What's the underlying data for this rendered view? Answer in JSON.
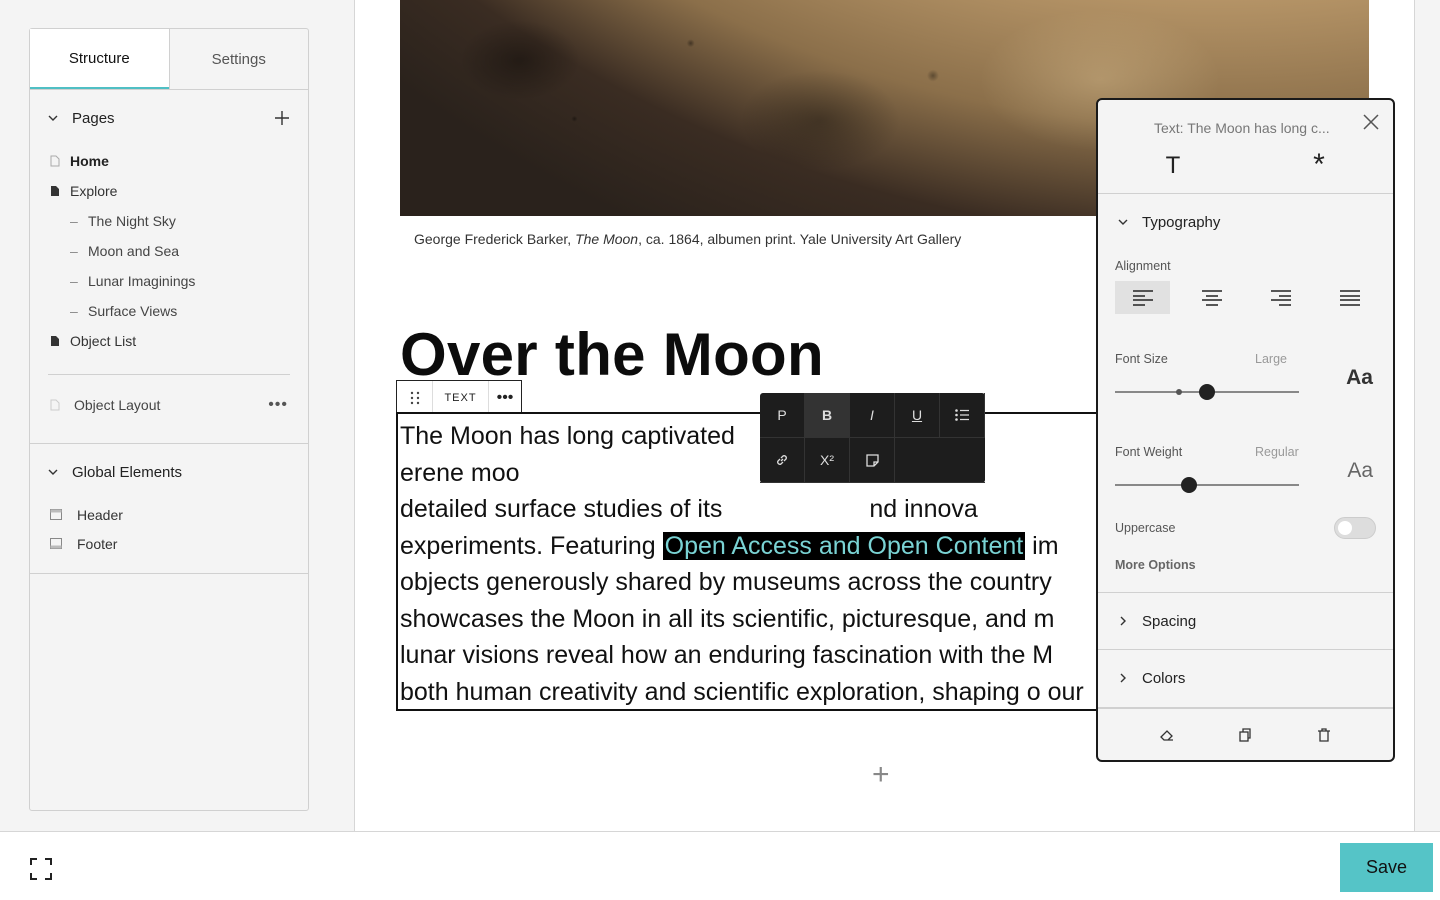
{
  "sidebar": {
    "tabs": [
      "Structure",
      "Settings"
    ],
    "pages_title": "Pages",
    "pages": [
      {
        "label": "Home"
      },
      {
        "label": "Explore"
      },
      {
        "label": "The Night Sky"
      },
      {
        "label": "Moon and Sea"
      },
      {
        "label": "Lunar Imaginings"
      },
      {
        "label": "Surface Views"
      },
      {
        "label": "Object List"
      }
    ],
    "object_layout": "Object Layout",
    "global_title": "Global Elements",
    "global_items": [
      "Header",
      "Footer"
    ]
  },
  "canvas": {
    "caption_pre": "George Frederick Barker, ",
    "caption_italic": "The Moon",
    "caption_post": ", ca. 1864, albumen print. Yale University Art Gallery",
    "heading": "Over the Moon",
    "block_label": "TEXT",
    "body_before": "The Moon has long captivated",
    "body_hidden1": " erene moo",
    "body_line2_a": "detailed surface studies of its ",
    "body_line2_b": "nd innova",
    "body_line3_a": "experiments. Featuring ",
    "body_highlight": "Open Access and Open Content",
    "body_line3_b": " im",
    "body_rest": "objects generously shared by museums across the country showcases the Moon in all its scientific, picturesque, and m lunar visions reveal how an enduring fascination with the M both human creativity and scientific exploration, shaping o our closest celestial neighbor."
  },
  "format_toolbar": {
    "row1": [
      "P",
      "B",
      "I",
      "U"
    ],
    "superscript": "X²"
  },
  "panel": {
    "title": "Text: The Moon has long c...",
    "tab_text": "T",
    "tab_style": "*",
    "typography": "Typography",
    "alignment": "Alignment",
    "font_size_label": "Font Size",
    "font_size_value": "Large",
    "font_size_level": 0.5,
    "font_weight_label": "Font Weight",
    "font_weight_value": "Regular",
    "font_weight_level": 0.4,
    "sample": "Aa",
    "uppercase": "Uppercase",
    "uppercase_on": false,
    "more_options": "More Options",
    "spacing": "Spacing",
    "colors": "Colors"
  },
  "bottom": {
    "save": "Save"
  },
  "colors": {
    "accent": "#55c4c7",
    "highlight_text": "#7ad3d4"
  }
}
